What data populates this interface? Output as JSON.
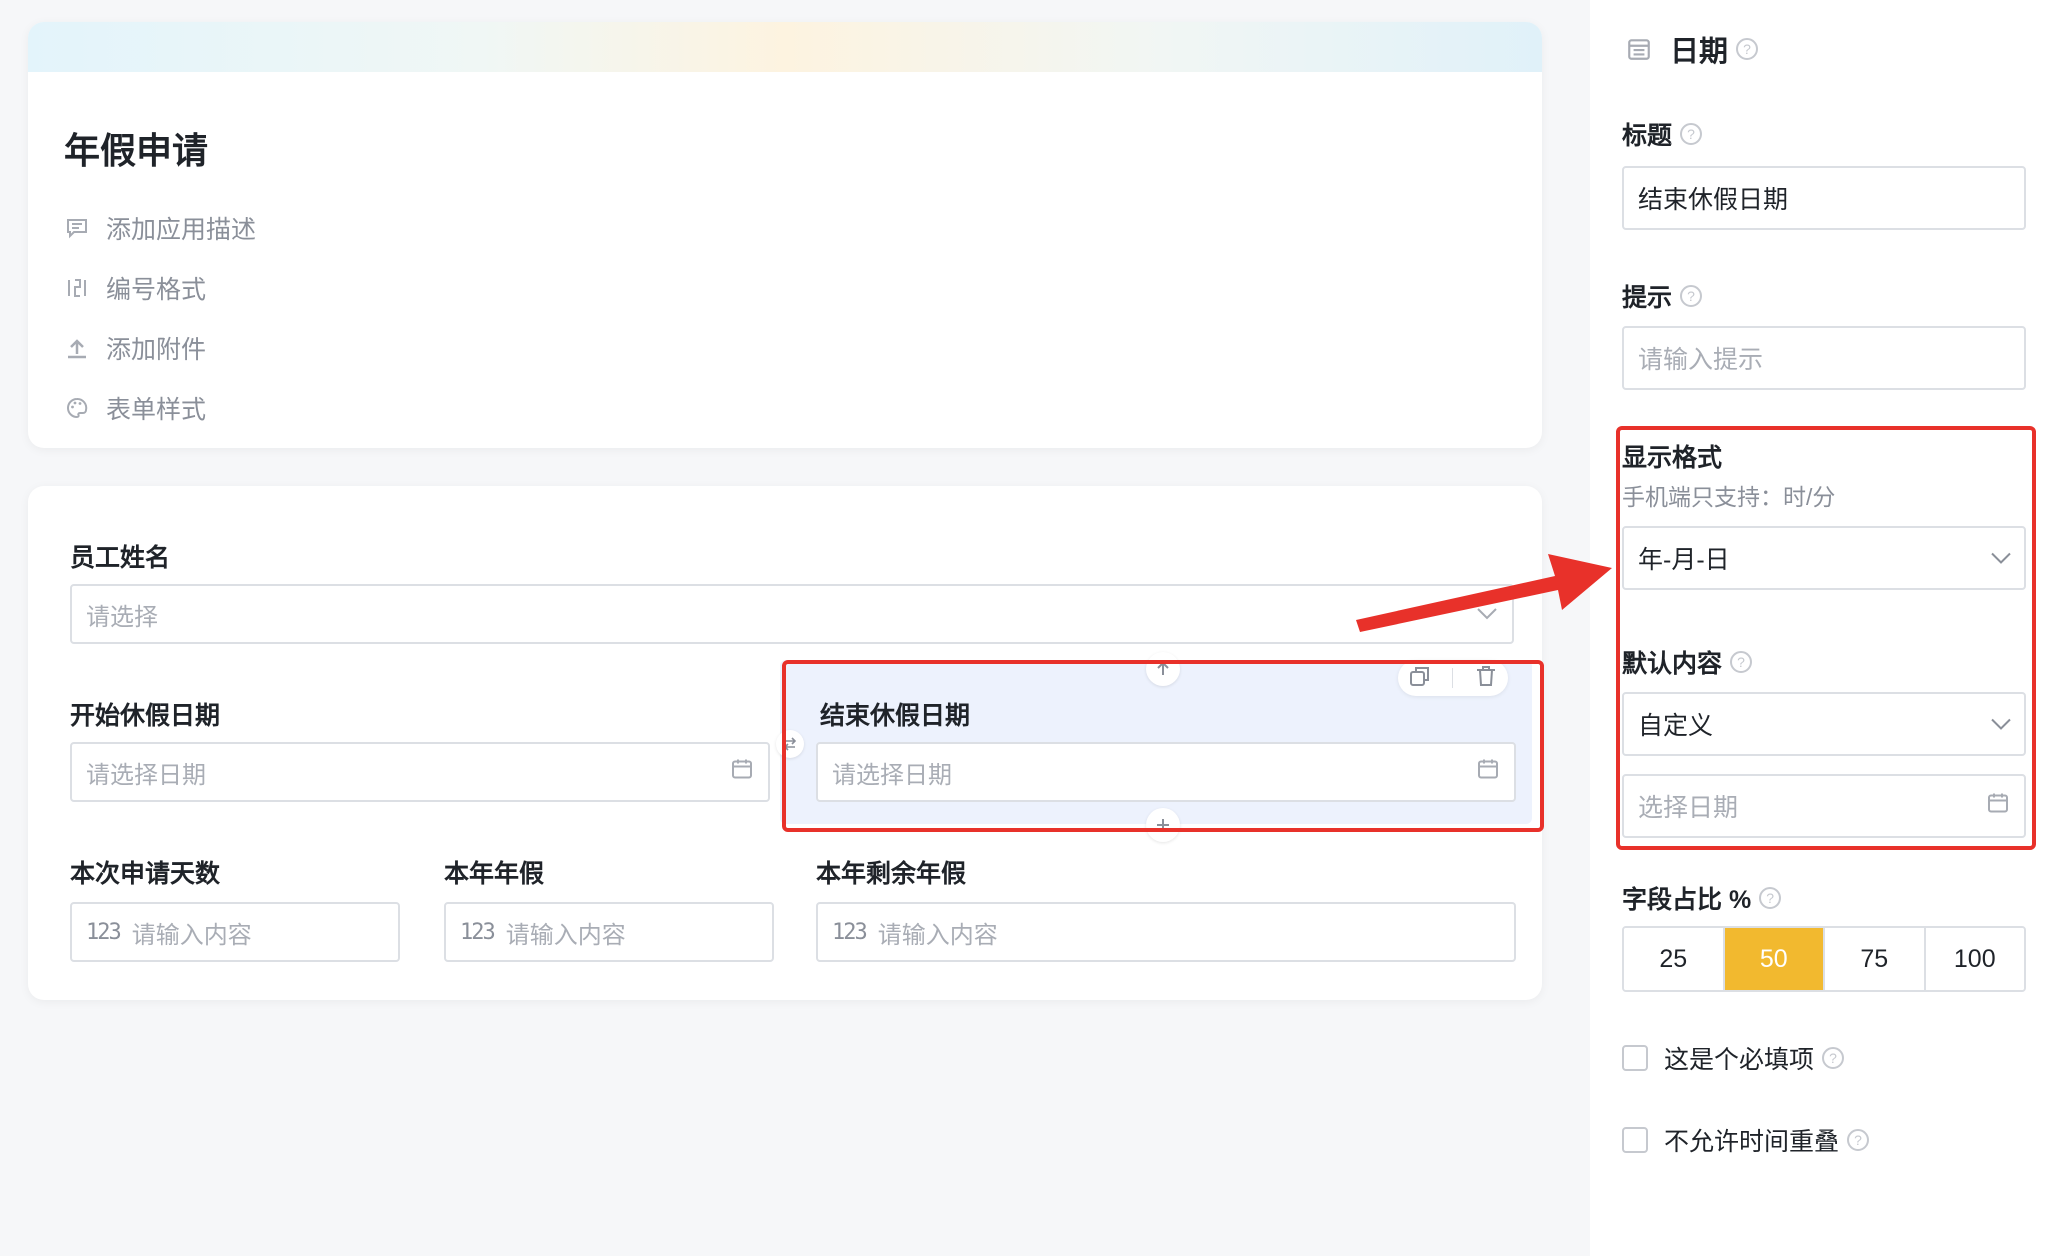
{
  "form": {
    "title": "年假申请",
    "meta_items": [
      {
        "label": "添加应用描述",
        "icon": "comment-icon"
      },
      {
        "label": "编号格式",
        "icon": "numbering-icon"
      },
      {
        "label": "添加附件",
        "icon": "upload-icon"
      },
      {
        "label": "表单样式",
        "icon": "palette-icon"
      }
    ]
  },
  "fields": {
    "employee": {
      "label": "员工姓名",
      "placeholder": "请选择"
    },
    "start_date": {
      "label": "开始休假日期",
      "placeholder": "请选择日期"
    },
    "end_date": {
      "label": "结束休假日期",
      "placeholder": "请选择日期"
    },
    "days": {
      "label": "本次申请天数",
      "prefix": "123",
      "placeholder": "请输入内容"
    },
    "annual": {
      "label": "本年年假",
      "prefix": "123",
      "placeholder": "请输入内容"
    },
    "remaining": {
      "label": "本年剩余年假",
      "prefix": "123",
      "placeholder": "请输入内容"
    }
  },
  "panel": {
    "header": "日期",
    "title_label": "标题",
    "title_value": "结束休假日期",
    "hint_label": "提示",
    "hint_placeholder": "请输入提示",
    "format_label": "显示格式",
    "format_note": "手机端只支持：时/分",
    "format_value": "年-月-日",
    "default_label": "默认内容",
    "default_value": "自定义",
    "default_date_placeholder": "选择日期",
    "width_label": "字段占比 %",
    "width_options": [
      "25",
      "50",
      "75",
      "100"
    ],
    "width_selected": "50",
    "required_label": "这是个必填项",
    "no_overlap_label": "不允许时间重叠"
  },
  "colors": {
    "accent": "#f2b92f",
    "highlight": "#e8312a",
    "selected_bg": "#edf2fd"
  }
}
